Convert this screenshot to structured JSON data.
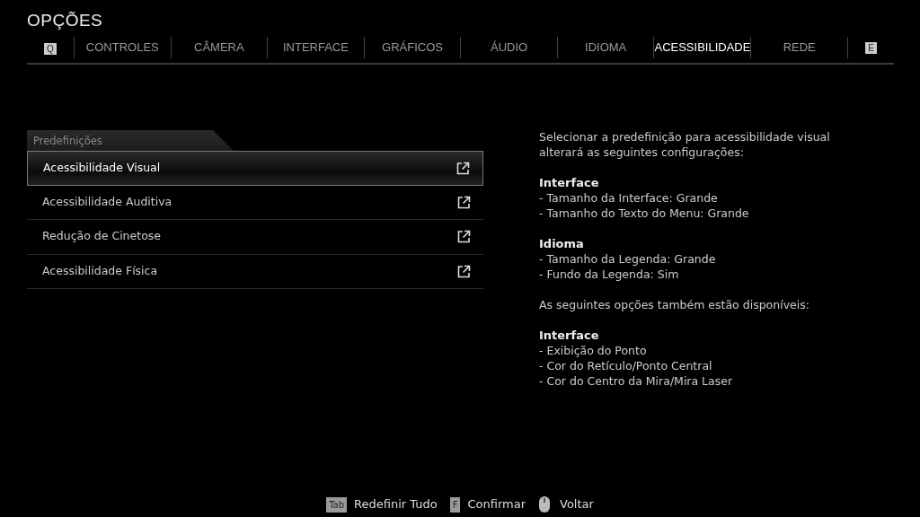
{
  "title": "OPÇÕES",
  "tab_keys": {
    "prev": "Q",
    "next": "E"
  },
  "tabs": [
    {
      "label": "CONTROLES",
      "selected": false
    },
    {
      "label": "CÂMERA",
      "selected": false
    },
    {
      "label": "INTERFACE",
      "selected": false
    },
    {
      "label": "GRÁFICOS",
      "selected": false
    },
    {
      "label": "ÁUDIO",
      "selected": false
    },
    {
      "label": "IDIOMA",
      "selected": false
    },
    {
      "label": "ACESSIBILIDADE",
      "selected": true
    },
    {
      "label": "REDE",
      "selected": false
    }
  ],
  "presets": {
    "header": "Predefinições",
    "items": [
      {
        "label": "Acessibilidade Visual",
        "selected": true
      },
      {
        "label": "Acessibilidade Auditiva",
        "selected": false
      },
      {
        "label": "Redução de Cinetose",
        "selected": false
      },
      {
        "label": "Acessibilidade Física",
        "selected": false
      }
    ]
  },
  "description": [
    {
      "kind": "text",
      "text": "Selecionar a predefinição para acessibilidade visual alterará as seguintes configurações:"
    },
    {
      "kind": "heading",
      "text": "Interface"
    },
    {
      "kind": "item",
      "text": "- Tamanho da Interface: Grande"
    },
    {
      "kind": "item",
      "text": "- Tamanho do Texto do Menu: Grande"
    },
    {
      "kind": "heading",
      "text": "Idioma"
    },
    {
      "kind": "item",
      "text": "- Tamanho da Legenda: Grande"
    },
    {
      "kind": "item",
      "text": "- Fundo da Legenda: Sim"
    },
    {
      "kind": "text",
      "text": "As seguintes opções também estão disponíveis:"
    },
    {
      "kind": "heading",
      "text": "Interface"
    },
    {
      "kind": "item",
      "text": "- Exibição do Ponto"
    },
    {
      "kind": "item",
      "text": "- Cor do Retículo/Ponto Central"
    },
    {
      "kind": "item",
      "text": "- Cor do Centro da Mira/Mira Laser"
    }
  ],
  "footer": [
    {
      "kind": "key",
      "key": "Tab",
      "label": "Redefinir Tudo"
    },
    {
      "kind": "key",
      "key": "F",
      "label": "Confirmar"
    },
    {
      "kind": "mouse",
      "label": "Voltar"
    }
  ]
}
